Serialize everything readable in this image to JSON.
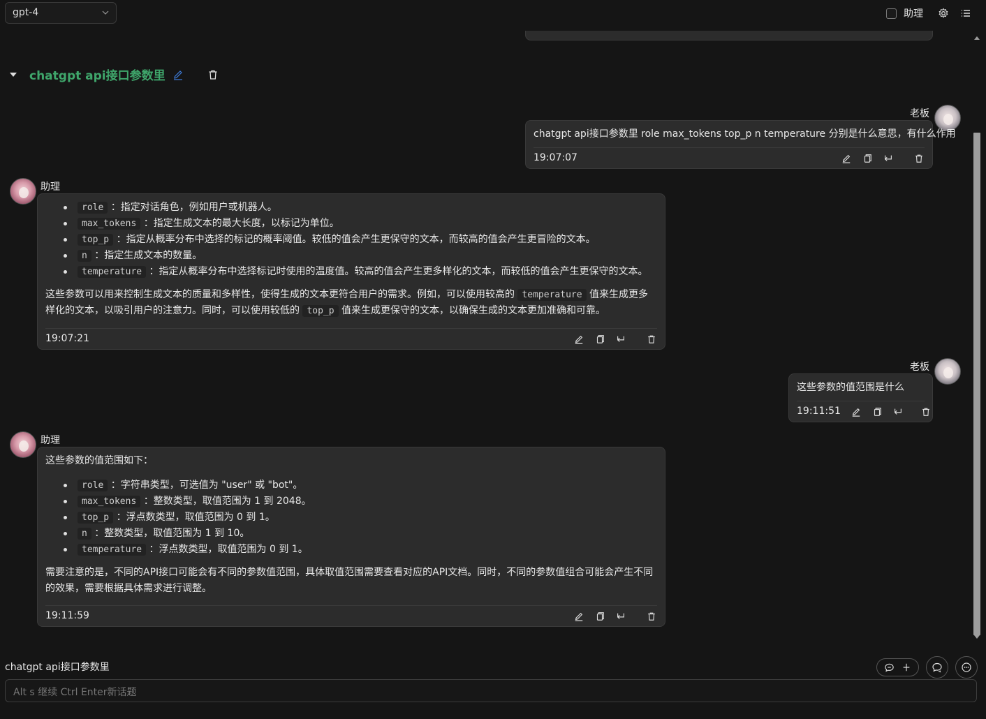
{
  "top": {
    "model": "gpt-4",
    "assistant_toggle_label": "助理"
  },
  "topic": {
    "title": "chatgpt api接口参数里"
  },
  "messages": [
    {
      "role": "user",
      "name": "老板",
      "text": "chatgpt api接口参数里 role max_tokens top_p n temperature 分别是什么意思，有什么作用",
      "time": "19:07:07"
    },
    {
      "role": "assistant",
      "name": "助理",
      "items": [
        {
          "code": "role",
          "desc": "：指定对话角色，例如用户或机器人。"
        },
        {
          "code": "max_tokens",
          "desc": "：指定生成文本的最大长度，以标记为单位。"
        },
        {
          "code": "top_p",
          "desc": "：指定从概率分布中选择的标记的概率阈值。较低的值会产生更保守的文本，而较高的值会产生更冒险的文本。"
        },
        {
          "code": "n",
          "desc": "：指定生成文本的数量。"
        },
        {
          "code": "temperature",
          "desc": "：指定从概率分布中选择标记时使用的温度值。较高的值会产生更多样化的文本，而较低的值会产生更保守的文本。"
        }
      ],
      "para_parts": [
        "这些参数可以用来控制生成文本的质量和多样性，使得生成的文本更符合用户的需求。例如，可以使用较高的 ",
        "temperature",
        " 值来生成更多样化的文本，以吸引用户的注意力。同时，可以使用较低的 ",
        "top_p",
        " 值来生成更保守的文本，以确保生成的文本更加准确和可靠。"
      ],
      "time": "19:07:21"
    },
    {
      "role": "user",
      "name": "老板",
      "text": "这些参数的值范围是什么",
      "time": "19:11:51"
    },
    {
      "role": "assistant",
      "name": "助理",
      "intro": "这些参数的值范围如下：",
      "items": [
        {
          "code": "role",
          "desc": "：字符串类型，可选值为 \"user\" 或 \"bot\"。"
        },
        {
          "code": "max_tokens",
          "desc": "：整数类型，取值范围为 1 到 2048。"
        },
        {
          "code": "top_p",
          "desc": "：浮点数类型，取值范围为 0 到 1。"
        },
        {
          "code": "n",
          "desc": "：整数类型，取值范围为 1 到 10。"
        },
        {
          "code": "temperature",
          "desc": "：浮点数类型，取值范围为 0 到 1。"
        }
      ],
      "para": "需要注意的是，不同的API接口可能会有不同的参数值范围，具体取值范围需要查看对应的API文档。同时，不同的参数值组合可能会产生不同的效果，需要根据具体需求进行调整。",
      "time": "19:11:59"
    }
  ],
  "bottom": {
    "topic_label": "chatgpt api接口参数里",
    "input_placeholder": "Alt s 继续  Ctrl Enter新话题"
  },
  "colors": {
    "background": "#151515",
    "bubble": "#2c2c2c",
    "topic_green": "#3fa66b",
    "edit_blue": "#3d7bd8"
  }
}
